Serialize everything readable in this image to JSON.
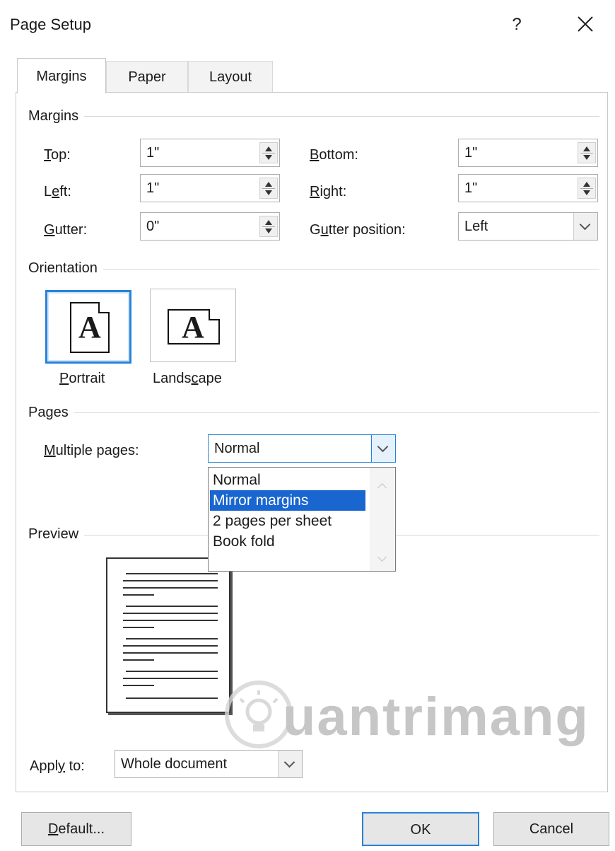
{
  "dialog": {
    "title": "Page Setup",
    "help": "?"
  },
  "tabs": [
    "Margins",
    "Paper",
    "Layout"
  ],
  "margins_group": {
    "title": "Margins",
    "top": {
      "label": "Top:",
      "value": "1\""
    },
    "left": {
      "label": "Left:",
      "value": "1\""
    },
    "gutter": {
      "label": "Gutter:",
      "value": "0\""
    },
    "bottom": {
      "label": "Bottom:",
      "value": "1\""
    },
    "right": {
      "label": "Right:",
      "value": "1\""
    },
    "gutter_position": {
      "label": "Gutter position:",
      "value": "Left"
    }
  },
  "orientation": {
    "title": "Orientation",
    "portrait": "Portrait",
    "landscape": "Landscape",
    "icon_letter": "A",
    "selected": "Portrait"
  },
  "pages": {
    "title": "Pages",
    "multiple_pages_label": "Multiple pages:",
    "multiple_pages_value": "Normal",
    "options": [
      "Normal",
      "Mirror margins",
      "2 pages per sheet",
      "Book fold"
    ],
    "highlighted": "Mirror margins"
  },
  "preview": {
    "title": "Preview"
  },
  "apply_to": {
    "label": "Apply to:",
    "value": "Whole document"
  },
  "buttons": {
    "default": "Default...",
    "ok": "OK",
    "cancel": "Cancel"
  },
  "watermark": {
    "text": "uantrimang"
  },
  "colors": {
    "accent": "#2a82d6",
    "selection": "#1a66d1"
  }
}
